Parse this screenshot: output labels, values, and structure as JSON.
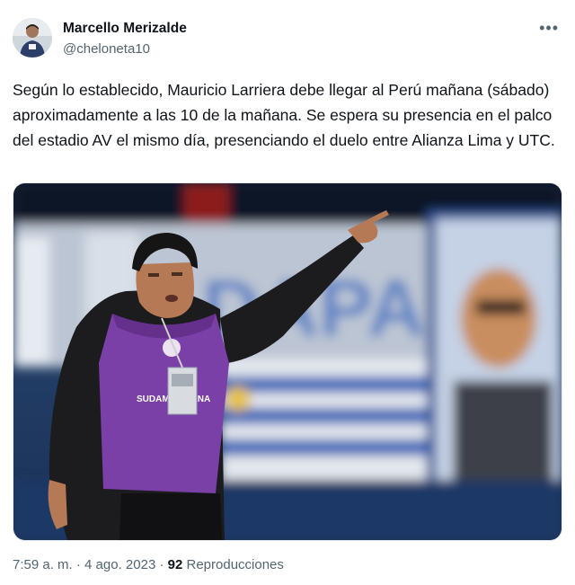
{
  "author": {
    "display_name": "Marcello Merizalde",
    "handle": "@cheloneta10",
    "avatar_icon": "profile-photo"
  },
  "more_icon": "•••",
  "tweet": {
    "text": "Según lo establecido, Mauricio Larriera debe llegar al Perú mañana (sábado) aproximadamente a las 10 de la mañana. Se espera su presencia en el palco del estadio AV el mismo día, presenciando el duelo entre Alianza Lima y UTC."
  },
  "photo": {
    "vest_text": "SUDAMERICANA",
    "banner_text": "DAPAS!",
    "colors": {
      "vest": "#7b3fa8",
      "jacket": "#1c1c1f",
      "flag_blue": "#3e67b8",
      "background": "#1a3257"
    }
  },
  "meta": {
    "time": "7:59 a. m.",
    "separator": " · ",
    "date": "4 ago. 2023",
    "views_count": "92",
    "views_label": "Reproducciones"
  }
}
